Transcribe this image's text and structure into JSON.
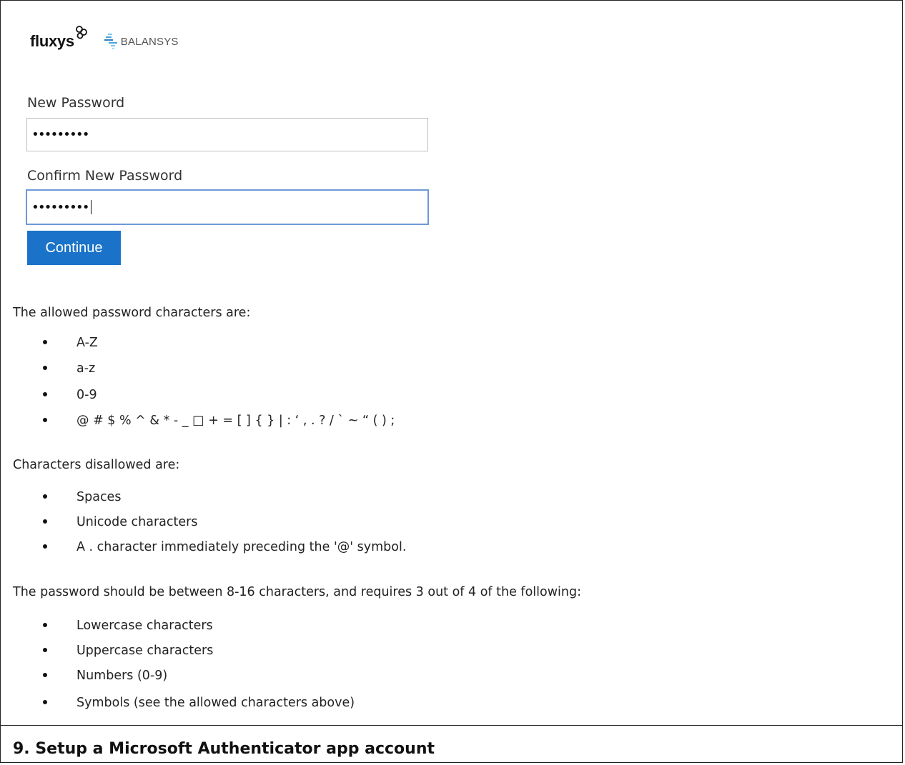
{
  "logos": {
    "fluxys": "fluxys",
    "balansys": "BALANSYS"
  },
  "form": {
    "new_password_label": "New Password",
    "new_password_value": "•••••••••",
    "confirm_password_label": "Confirm New Password",
    "confirm_password_value": "•••••••••",
    "continue_label": "Continue"
  },
  "allowed": {
    "intro": "The allowed password characters are:",
    "items": [
      "A-Z",
      "a-z",
      "0-9",
      "@ # $ % ^ & * - _ □ + = [ ] { } | : ‘ , . ? / ` ~ “ ( ) ;"
    ]
  },
  "disallowed": {
    "intro": "Characters disallowed are:",
    "items": [
      "Spaces",
      "Unicode characters",
      "A . character immediately preceding the '@' symbol."
    ]
  },
  "requirements": {
    "intro": "The password should be between 8-16 characters, and requires 3 out of 4 of the following:",
    "items": [
      "Lowercase characters",
      "Uppercase characters",
      "Numbers (0-9)",
      "Symbols (see the allowed characters above)"
    ]
  },
  "section": {
    "heading": "9. Setup a Microsoft Authenticator app account"
  },
  "colors": {
    "button_bg": "#1a73c8",
    "focus_border": "#6f98d8",
    "fluxys_accent": "#111111",
    "balansys_accent": "#4aa3d8"
  }
}
